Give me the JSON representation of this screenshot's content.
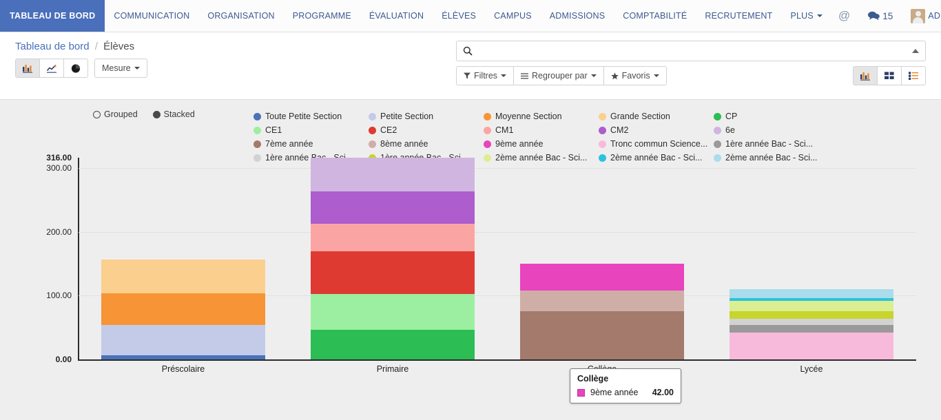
{
  "navbar": {
    "brand": "TABLEAU DE BORD",
    "items": [
      {
        "label": "COMMUNICATION",
        "has_caret": false
      },
      {
        "label": "ORGANISATION",
        "has_caret": false
      },
      {
        "label": "PROGRAMME",
        "has_caret": false
      },
      {
        "label": "ÉVALUATION",
        "has_caret": false
      },
      {
        "label": "ÉLÈVES",
        "has_caret": false
      },
      {
        "label": "CAMPUS",
        "has_caret": false
      },
      {
        "label": "ADMISSIONS",
        "has_caret": false
      },
      {
        "label": "COMPTABILITÉ",
        "has_caret": false
      },
      {
        "label": "RECRUTEMENT",
        "has_caret": false
      },
      {
        "label": "PLUS",
        "has_caret": true
      }
    ],
    "mention_glyph": "@",
    "chat_glyph": "💬",
    "chat_count": "15",
    "user_name": "ADMIN"
  },
  "control_panel": {
    "breadcrumb_root": "Tableau de bord",
    "breadcrumb_sep": "/",
    "breadcrumb_current": "Élèves",
    "chart_type_buttons": [
      {
        "name": "bar-chart-icon",
        "active": true
      },
      {
        "name": "line-chart-icon",
        "active": false
      },
      {
        "name": "pie-chart-icon",
        "active": false
      }
    ],
    "measure_label": "Mesure",
    "search_placeholder": "",
    "search_value": "",
    "filters_label": "Filtres",
    "groupby_label": "Regrouper par",
    "favorites_label": "Favoris",
    "view_buttons": [
      {
        "name": "graph-view-icon",
        "active": true
      },
      {
        "name": "kanban-view-icon",
        "active": false
      },
      {
        "name": "list-view-icon",
        "active": false
      }
    ]
  },
  "chart_controls": {
    "grouped_label": "Grouped",
    "stacked_label": "Stacked",
    "selected_mode": "Stacked"
  },
  "tooltip": {
    "title": "Collège",
    "series_label": "9ème année",
    "value": "42.00",
    "color": "#e844bd"
  },
  "chart_data": {
    "type": "bar",
    "stacked": true,
    "title": "",
    "xlabel": "",
    "ylabel": "",
    "ylim": [
      0,
      316
    ],
    "grid": true,
    "legend_position": "top",
    "y_ticks": [
      "316.00",
      "300.00",
      "200.00",
      "100.00",
      "0.00"
    ],
    "y_tick_values": [
      316,
      300,
      200,
      100,
      0
    ],
    "y_tick_bold": [
      true,
      false,
      false,
      false,
      true
    ],
    "categories": [
      "Préscolaire",
      "Primaire",
      "Collège",
      "Lycée"
    ],
    "series": [
      {
        "name": "Toute Petite Section",
        "color": "#4a72b8",
        "values": [
          6,
          0,
          0,
          0
        ]
      },
      {
        "name": "Petite Section",
        "color": "#c3cbe9",
        "values": [
          48,
          0,
          0,
          0
        ]
      },
      {
        "name": "Moyenne Section",
        "color": "#f79435",
        "values": [
          50,
          0,
          0,
          0
        ]
      },
      {
        "name": "Grande Section",
        "color": "#fbcf8e",
        "values": [
          52,
          0,
          0,
          0
        ]
      },
      {
        "name": "CP",
        "color": "#2cbd54",
        "values": [
          0,
          46,
          0,
          0
        ]
      },
      {
        "name": "CE1",
        "color": "#9cefa1",
        "values": [
          0,
          56,
          0,
          0
        ]
      },
      {
        "name": "CE2",
        "color": "#de3a32",
        "values": [
          0,
          67,
          0,
          0
        ]
      },
      {
        "name": "CM1",
        "color": "#faa5a3",
        "values": [
          0,
          44,
          0,
          0
        ]
      },
      {
        "name": "CM2",
        "color": "#ad5dcd",
        "values": [
          0,
          50,
          0,
          0
        ]
      },
      {
        "name": "6e",
        "color": "#cfb5e0",
        "values": [
          0,
          53,
          0,
          0
        ]
      },
      {
        "name": "7ème année",
        "color": "#a37a6c",
        "values": [
          0,
          0,
          76,
          0
        ]
      },
      {
        "name": "8ème année",
        "color": "#cfaea7",
        "values": [
          0,
          0,
          32,
          0
        ]
      },
      {
        "name": "9ème année",
        "color": "#e844bd",
        "values": [
          0,
          0,
          42,
          0
        ]
      },
      {
        "name": "Tronc commun Science...",
        "color": "#f8badb",
        "values": [
          0,
          0,
          0,
          42
        ]
      },
      {
        "name": "1ère année Bac - Sci...",
        "color": "#9a9a9a",
        "values": [
          0,
          0,
          0,
          12
        ]
      },
      {
        "name": "1ère année Bac - Sci...",
        "color": "#d2d2d2",
        "values": [
          0,
          0,
          0,
          10
        ]
      },
      {
        "name": "1ère année Bac - Sci...",
        "color": "#c7d52d",
        "values": [
          0,
          0,
          0,
          12
        ]
      },
      {
        "name": "2ème année Bac - Sci...",
        "color": "#dcee92",
        "values": [
          0,
          0,
          0,
          16
        ]
      },
      {
        "name": "2ème année Bac - Sci...",
        "color": "#2ac3dc",
        "values": [
          0,
          0,
          0,
          4
        ]
      },
      {
        "name": "2ème année Bac - Sci...",
        "color": "#a9dcec",
        "values": [
          0,
          0,
          0,
          14
        ]
      }
    ]
  }
}
